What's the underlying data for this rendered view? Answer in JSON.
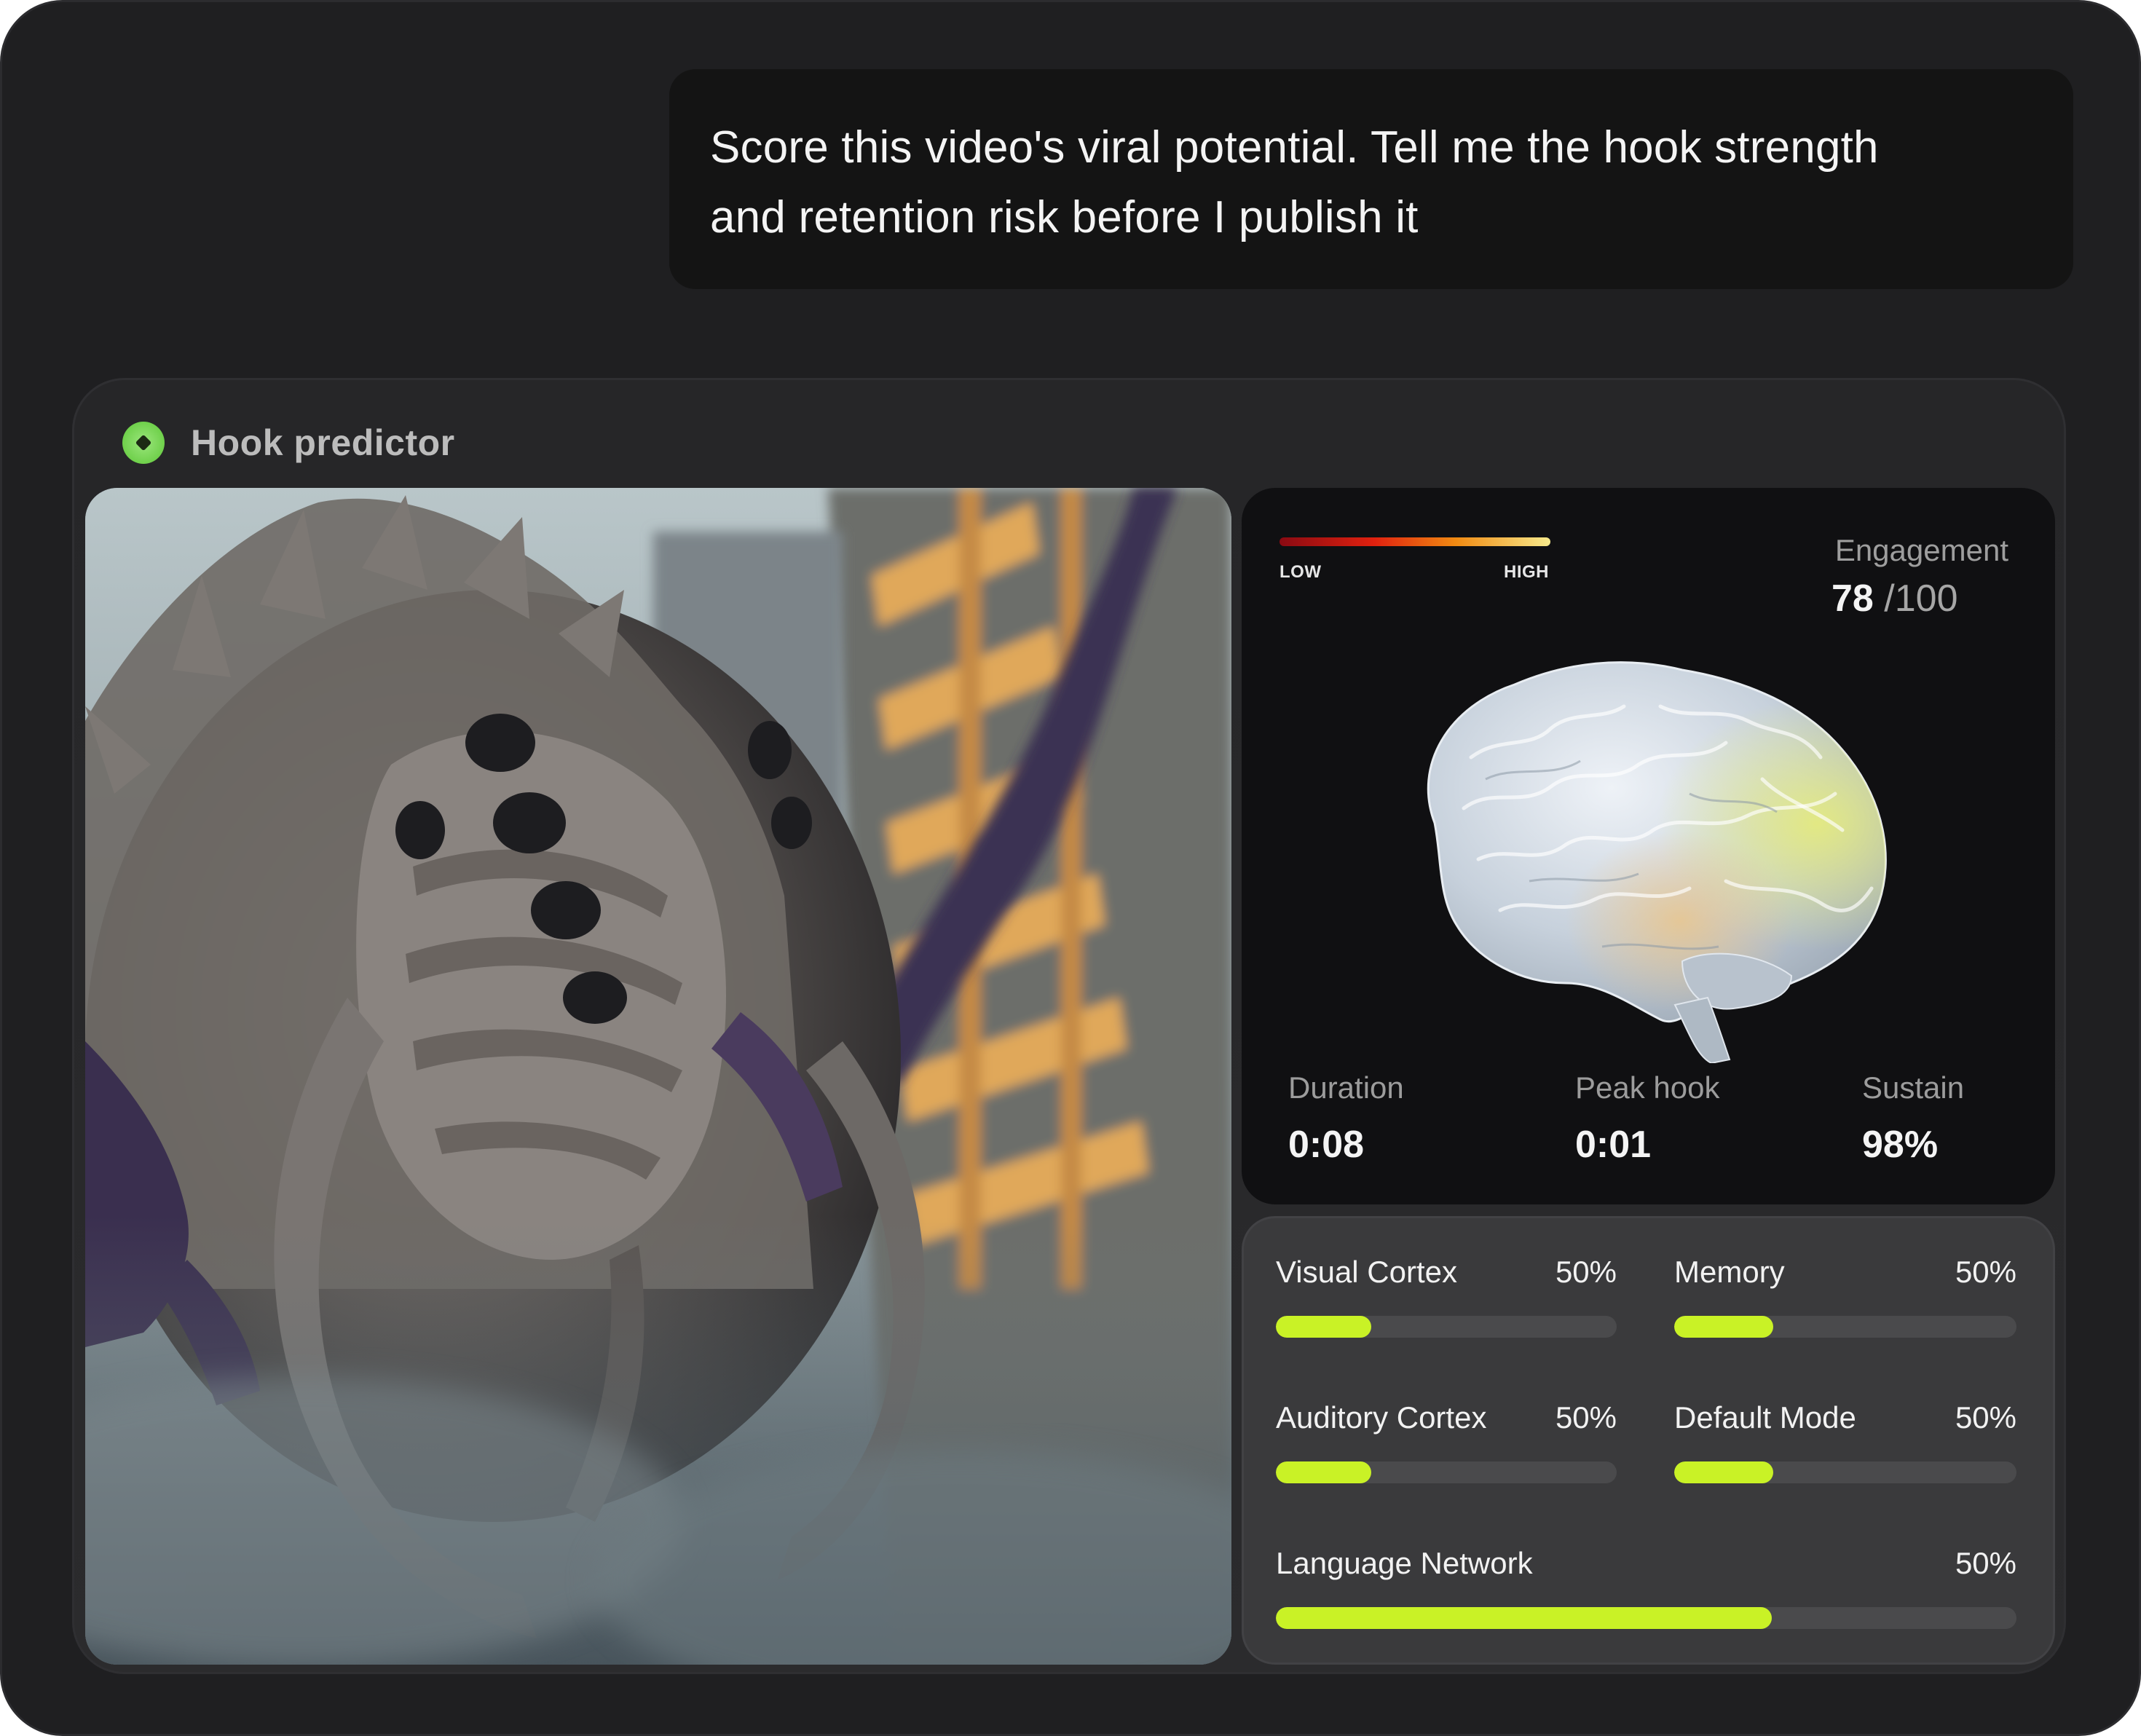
{
  "prompt": {
    "line1": "Score this video's viral potential. Tell me the hook strength",
    "line2": "and retention risk before I publish it"
  },
  "widget": {
    "title": "Hook predictor",
    "status_color": "#6fd04b"
  },
  "video": {
    "alt": "Monster creature still frame"
  },
  "brain_panel": {
    "legend_low": "LOW",
    "legend_high": "HIGH",
    "engagement_label": "Engagement",
    "engagement_score": "78",
    "engagement_max": "/100",
    "stats": [
      {
        "label": "Duration",
        "value": "0:08"
      },
      {
        "label": "Peak hook",
        "value": "0:01"
      },
      {
        "label": "Sustain",
        "value": "98%"
      }
    ]
  },
  "metrics": {
    "accent_color": "#c9f226",
    "items": [
      {
        "name": "Visual Cortex",
        "value": "50%",
        "fill_fraction": 0.28
      },
      {
        "name": "Memory",
        "value": "50%",
        "fill_fraction": 0.29
      },
      {
        "name": "Auditory Cortex",
        "value": "50%",
        "fill_fraction": 0.28
      },
      {
        "name": "Default Mode",
        "value": "50%",
        "fill_fraction": 0.29
      },
      {
        "name": "Language Network",
        "value": "50%",
        "fill_fraction": 0.67
      }
    ]
  }
}
